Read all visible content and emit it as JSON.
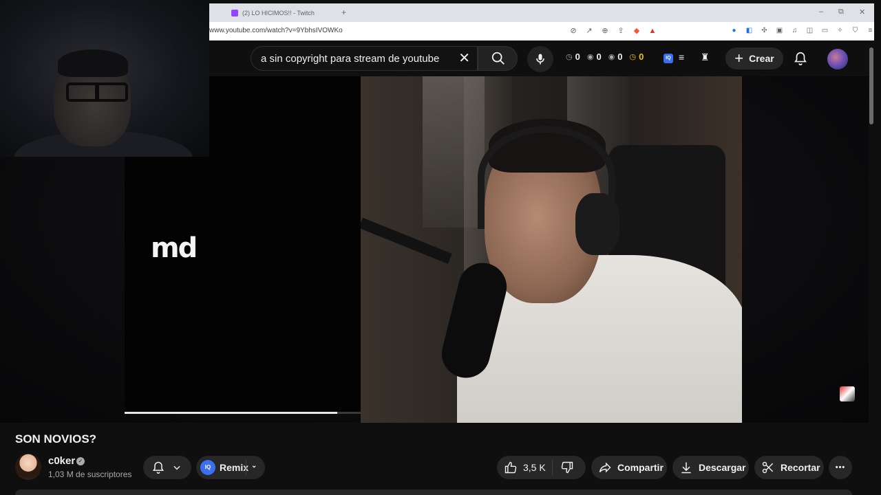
{
  "browser": {
    "tab_title": "(2) LO HICIMOS!! - Twitch",
    "new_tab": "+",
    "url": "www.youtube.com/watch?v=9YbhsIVOWKo",
    "window_controls": {
      "minimize": "–",
      "restore": "⧉",
      "close": "✕"
    }
  },
  "header": {
    "search_query": "a sin copyright para stream de youtube",
    "stats": [
      {
        "icon": "clock-icon",
        "value": "0"
      },
      {
        "icon": "eye-icon",
        "value": "0"
      },
      {
        "icon": "eye-icon",
        "value": "0"
      },
      {
        "icon": "clock-icon",
        "value": "0",
        "highlight": true
      }
    ],
    "iq_label": "IQ",
    "create_label": "Crear"
  },
  "player": {
    "overlay_logo": "md",
    "progress_fraction": 0.9
  },
  "video": {
    "title": "SON NOVIOS?",
    "channel_name": "c0ker",
    "subscribers": "1,03 M de suscriptores"
  },
  "actions": {
    "remix_label": "Remix",
    "remix_iq": "IQ",
    "likes": "3,5 K",
    "share_label": "Compartir",
    "download_label": "Descargar",
    "clip_label": "Recortar",
    "more_label": "•••"
  },
  "colors": {
    "background": "#0f0f0f",
    "pill": "#272727",
    "accent_blue": "#3a6ff2",
    "stat_highlight": "#f2c200"
  }
}
